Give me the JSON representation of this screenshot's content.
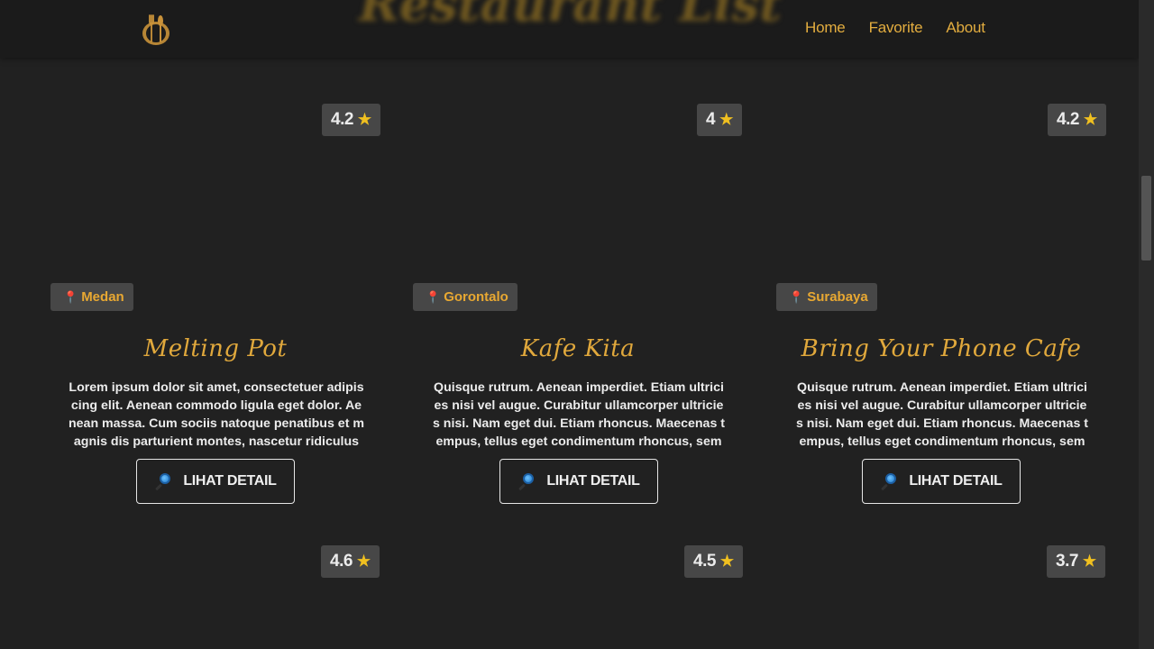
{
  "header": {
    "hero_title": "Restaurant List",
    "nav": [
      "Home",
      "Favorite",
      "About"
    ]
  },
  "cards": [
    {
      "rating": "4.2",
      "city": "Medan",
      "name": "Melting Pot",
      "description": "Lorem ipsum dolor sit amet, consectetuer adipiscing elit. Aenean commodo ligula eget dolor. Aenean massa. Cum sociis natoque penatibus et magnis dis parturient montes, nascetur ridiculus mus. Donec q...",
      "button": "LIHAT DETAIL"
    },
    {
      "rating": "4",
      "city": "Gorontalo",
      "name": "Kafe Kita",
      "description": "Quisque rutrum. Aenean imperdiet. Etiam ultricies nisi vel augue. Curabitur ullamcorper ultricies nisi. Nam eget dui. Etiam rhoncus. Maecenas tempus, tellus eget condimentum rhoncus, sem quam sempe...",
      "button": "LIHAT DETAIL"
    },
    {
      "rating": "4.2",
      "city": "Surabaya",
      "name": "Bring Your Phone Cafe",
      "description": "Quisque rutrum. Aenean imperdiet. Etiam ultricies nisi vel augue. Curabitur ullamcorper ultricies nisi. Nam eget dui. Etiam rhoncus. Maecenas tempus, tellus eget condimentum rhoncus, sem quam sempe...",
      "button": "LIHAT DETAIL"
    }
  ],
  "next_row_ratings": [
    "4.6",
    "4.5",
    "3.7"
  ],
  "icons": {
    "logo": "fork-spoon-logo",
    "rating": "star-icon",
    "city": "map-pin-icon",
    "button": "magnifier-icon"
  },
  "colors": {
    "accent": "#e0a83c",
    "background": "#212121",
    "badge": "#474747",
    "star": "#f0c020",
    "pin": "#e8218f"
  }
}
